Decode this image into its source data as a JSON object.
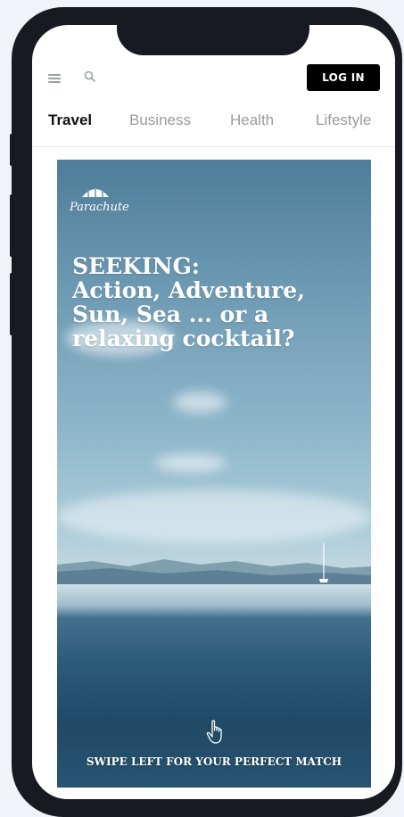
{
  "header": {
    "login_label": "LOG IN"
  },
  "tabs": [
    {
      "label": "Travel",
      "active": true
    },
    {
      "label": "Business",
      "active": false
    },
    {
      "label": "Health",
      "active": false
    },
    {
      "label": "Lifestyle",
      "active": false
    }
  ],
  "hero": {
    "brand": "Parachute",
    "headline_lines": [
      "SEEKING:",
      "Action, Adventure,",
      "Sun, Sea ... or a",
      "relaxing cocktail?"
    ],
    "cta": "SWIPE LEFT FOR YOUR PERFECT MATCH"
  },
  "icons": {
    "menu": "hamburger-icon",
    "search": "search-icon",
    "logo": "parachute-icon",
    "swipe": "hand-pointer-icon"
  },
  "colors": {
    "page_background": "#f0f4f8",
    "phone_frame": "#171a21",
    "login_button": "#000000",
    "active_tab": "#111111",
    "inactive_tab": "#9b9b9b"
  }
}
